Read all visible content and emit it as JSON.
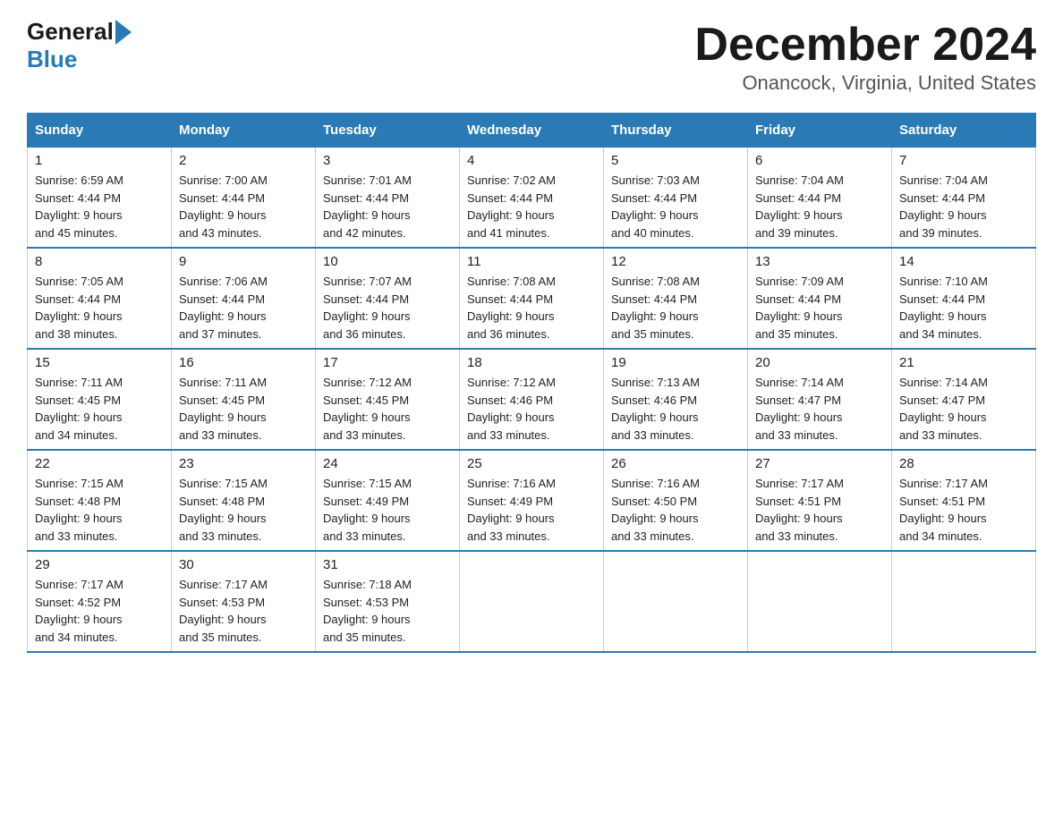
{
  "logo": {
    "general": "General",
    "blue": "Blue"
  },
  "title": "December 2024",
  "location": "Onancock, Virginia, United States",
  "headers": [
    "Sunday",
    "Monday",
    "Tuesday",
    "Wednesday",
    "Thursday",
    "Friday",
    "Saturday"
  ],
  "weeks": [
    [
      {
        "day": "1",
        "sunrise": "6:59 AM",
        "sunset": "4:44 PM",
        "daylight": "9 hours and 45 minutes."
      },
      {
        "day": "2",
        "sunrise": "7:00 AM",
        "sunset": "4:44 PM",
        "daylight": "9 hours and 43 minutes."
      },
      {
        "day": "3",
        "sunrise": "7:01 AM",
        "sunset": "4:44 PM",
        "daylight": "9 hours and 42 minutes."
      },
      {
        "day": "4",
        "sunrise": "7:02 AM",
        "sunset": "4:44 PM",
        "daylight": "9 hours and 41 minutes."
      },
      {
        "day": "5",
        "sunrise": "7:03 AM",
        "sunset": "4:44 PM",
        "daylight": "9 hours and 40 minutes."
      },
      {
        "day": "6",
        "sunrise": "7:04 AM",
        "sunset": "4:44 PM",
        "daylight": "9 hours and 39 minutes."
      },
      {
        "day": "7",
        "sunrise": "7:04 AM",
        "sunset": "4:44 PM",
        "daylight": "9 hours and 39 minutes."
      }
    ],
    [
      {
        "day": "8",
        "sunrise": "7:05 AM",
        "sunset": "4:44 PM",
        "daylight": "9 hours and 38 minutes."
      },
      {
        "day": "9",
        "sunrise": "7:06 AM",
        "sunset": "4:44 PM",
        "daylight": "9 hours and 37 minutes."
      },
      {
        "day": "10",
        "sunrise": "7:07 AM",
        "sunset": "4:44 PM",
        "daylight": "9 hours and 36 minutes."
      },
      {
        "day": "11",
        "sunrise": "7:08 AM",
        "sunset": "4:44 PM",
        "daylight": "9 hours and 36 minutes."
      },
      {
        "day": "12",
        "sunrise": "7:08 AM",
        "sunset": "4:44 PM",
        "daylight": "9 hours and 35 minutes."
      },
      {
        "day": "13",
        "sunrise": "7:09 AM",
        "sunset": "4:44 PM",
        "daylight": "9 hours and 35 minutes."
      },
      {
        "day": "14",
        "sunrise": "7:10 AM",
        "sunset": "4:44 PM",
        "daylight": "9 hours and 34 minutes."
      }
    ],
    [
      {
        "day": "15",
        "sunrise": "7:11 AM",
        "sunset": "4:45 PM",
        "daylight": "9 hours and 34 minutes."
      },
      {
        "day": "16",
        "sunrise": "7:11 AM",
        "sunset": "4:45 PM",
        "daylight": "9 hours and 33 minutes."
      },
      {
        "day": "17",
        "sunrise": "7:12 AM",
        "sunset": "4:45 PM",
        "daylight": "9 hours and 33 minutes."
      },
      {
        "day": "18",
        "sunrise": "7:12 AM",
        "sunset": "4:46 PM",
        "daylight": "9 hours and 33 minutes."
      },
      {
        "day": "19",
        "sunrise": "7:13 AM",
        "sunset": "4:46 PM",
        "daylight": "9 hours and 33 minutes."
      },
      {
        "day": "20",
        "sunrise": "7:14 AM",
        "sunset": "4:47 PM",
        "daylight": "9 hours and 33 minutes."
      },
      {
        "day": "21",
        "sunrise": "7:14 AM",
        "sunset": "4:47 PM",
        "daylight": "9 hours and 33 minutes."
      }
    ],
    [
      {
        "day": "22",
        "sunrise": "7:15 AM",
        "sunset": "4:48 PM",
        "daylight": "9 hours and 33 minutes."
      },
      {
        "day": "23",
        "sunrise": "7:15 AM",
        "sunset": "4:48 PM",
        "daylight": "9 hours and 33 minutes."
      },
      {
        "day": "24",
        "sunrise": "7:15 AM",
        "sunset": "4:49 PM",
        "daylight": "9 hours and 33 minutes."
      },
      {
        "day": "25",
        "sunrise": "7:16 AM",
        "sunset": "4:49 PM",
        "daylight": "9 hours and 33 minutes."
      },
      {
        "day": "26",
        "sunrise": "7:16 AM",
        "sunset": "4:50 PM",
        "daylight": "9 hours and 33 minutes."
      },
      {
        "day": "27",
        "sunrise": "7:17 AM",
        "sunset": "4:51 PM",
        "daylight": "9 hours and 33 minutes."
      },
      {
        "day": "28",
        "sunrise": "7:17 AM",
        "sunset": "4:51 PM",
        "daylight": "9 hours and 34 minutes."
      }
    ],
    [
      {
        "day": "29",
        "sunrise": "7:17 AM",
        "sunset": "4:52 PM",
        "daylight": "9 hours and 34 minutes."
      },
      {
        "day": "30",
        "sunrise": "7:17 AM",
        "sunset": "4:53 PM",
        "daylight": "9 hours and 35 minutes."
      },
      {
        "day": "31",
        "sunrise": "7:18 AM",
        "sunset": "4:53 PM",
        "daylight": "9 hours and 35 minutes."
      },
      null,
      null,
      null,
      null
    ]
  ],
  "labels": {
    "sunrise": "Sunrise:",
    "sunset": "Sunset:",
    "daylight": "Daylight:"
  }
}
